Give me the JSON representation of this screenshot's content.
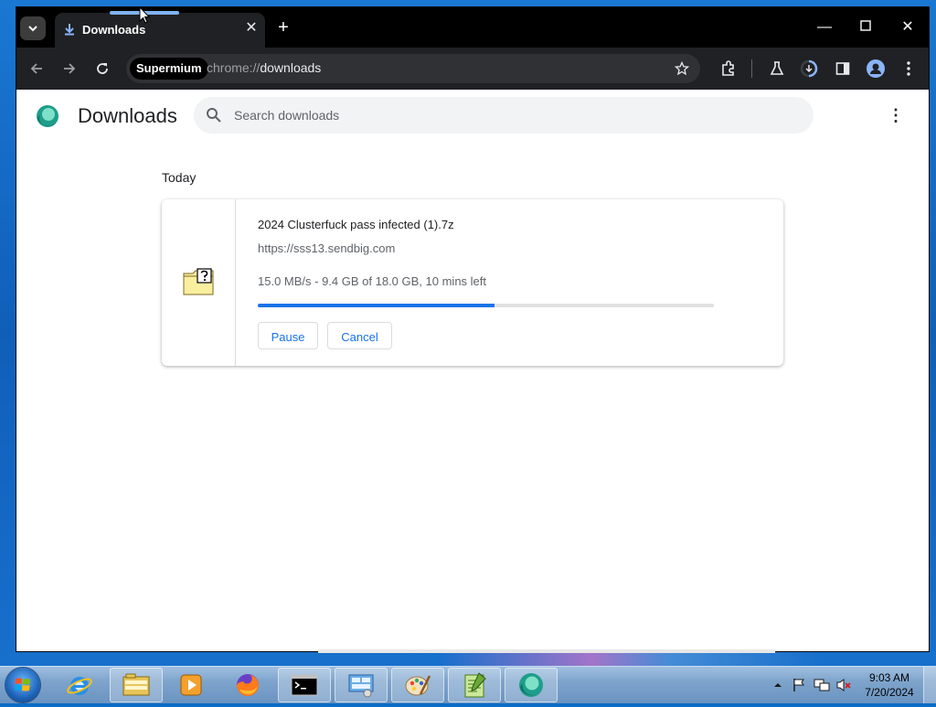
{
  "browser": {
    "tab": {
      "title": "Downloads"
    },
    "omnibox": {
      "chip": "Supermium",
      "url_prefix": "chrome://",
      "url_path": "downloads"
    }
  },
  "page": {
    "title": "Downloads",
    "search": {
      "placeholder": "Search downloads"
    },
    "section_label": "Today",
    "download": {
      "file_name": "2024 Clusterfuck pass infected (1).7z",
      "url": "https://sss13.sendbig.com",
      "status": "15.0 MB/s - 9.4 GB of 18.0 GB, 10 mins left",
      "progress": 0.52,
      "pause_label": "Pause",
      "cancel_label": "Cancel"
    }
  },
  "taskbar": {
    "time": "9:03 AM",
    "date": "7/20/2024",
    "apps": [
      "explorer-icon",
      "internet-explorer-icon",
      "file-explorer-icon",
      "media-player-icon",
      "firefox-icon",
      "cmd-icon",
      "control-panel-icon",
      "paint-icon",
      "notepad-plus-icon",
      "supermium-icon"
    ]
  },
  "colors": {
    "accent": "#1a73e8",
    "tabstrip": "#000000",
    "toolbar": "#202124"
  }
}
